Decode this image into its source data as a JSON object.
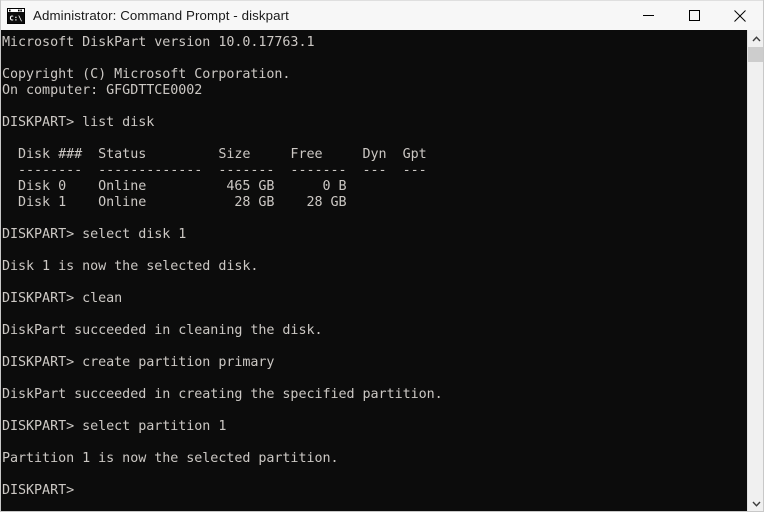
{
  "window": {
    "title": "Administrator: Command Prompt - diskpart",
    "icon": "command-prompt-icon",
    "background_color": "#0c0c0c",
    "titlebar_color": "#f7f7f7",
    "text_color": "#ccc8c4"
  },
  "titlebar_buttons": {
    "minimize_label": "Minimize",
    "maximize_label": "Maximize",
    "close_label": "Close"
  },
  "scrollbar": {
    "up_arrow": "chevron-up-icon",
    "down_arrow": "chevron-down-icon",
    "thumb_position_percent": 0,
    "thumb_size_percent": 3
  },
  "console": {
    "lines": [
      "Microsoft DiskPart version 10.0.17763.1",
      "",
      "Copyright (C) Microsoft Corporation.",
      "On computer: GFGDTTCE0002",
      "",
      "DISKPART> list disk",
      "",
      "  Disk ###  Status         Size     Free     Dyn  Gpt",
      "  --------  -------------  -------  -------  ---  ---",
      "  Disk 0    Online          465 GB      0 B",
      "  Disk 1    Online           28 GB    28 GB",
      "",
      "DISKPART> select disk 1",
      "",
      "Disk 1 is now the selected disk.",
      "",
      "DISKPART> clean",
      "",
      "DiskPart succeeded in cleaning the disk.",
      "",
      "DISKPART> create partition primary",
      "",
      "DiskPart succeeded in creating the specified partition.",
      "",
      "DISKPART> select partition 1",
      "",
      "Partition 1 is now the selected partition.",
      "",
      "DISKPART>"
    ],
    "text": "Microsoft DiskPart version 10.0.17763.1\n\nCopyright (C) Microsoft Corporation.\nOn computer: GFGDTTCE0002\n\nDISKPART> list disk\n\n  Disk ###  Status         Size     Free     Dyn  Gpt\n  --------  -------------  -------  -------  ---  ---\n  Disk 0    Online          465 GB      0 B\n  Disk 1    Online           28 GB    28 GB\n\nDISKPART> select disk 1\n\nDisk 1 is now the selected disk.\n\nDISKPART> clean\n\nDiskPart succeeded in cleaning the disk.\n\nDISKPART> create partition primary\n\nDiskPart succeeded in creating the specified partition.\n\nDISKPART> select partition 1\n\nPartition 1 is now the selected partition.\n\nDISKPART>"
  },
  "disk_table": {
    "headers": [
      "Disk ###",
      "Status",
      "Size",
      "Free",
      "Dyn",
      "Gpt"
    ],
    "rows": [
      [
        "Disk 0",
        "Online",
        "465 GB",
        "0 B",
        "",
        ""
      ],
      [
        "Disk 1",
        "Online",
        "28 GB",
        "28 GB",
        "",
        ""
      ]
    ]
  },
  "session": {
    "version": "10.0.17763.1",
    "computer": "GFGDTTCE0002",
    "prompt": "DISKPART>",
    "commands": [
      "list disk",
      "select disk 1",
      "clean",
      "create partition primary",
      "select partition 1"
    ]
  }
}
